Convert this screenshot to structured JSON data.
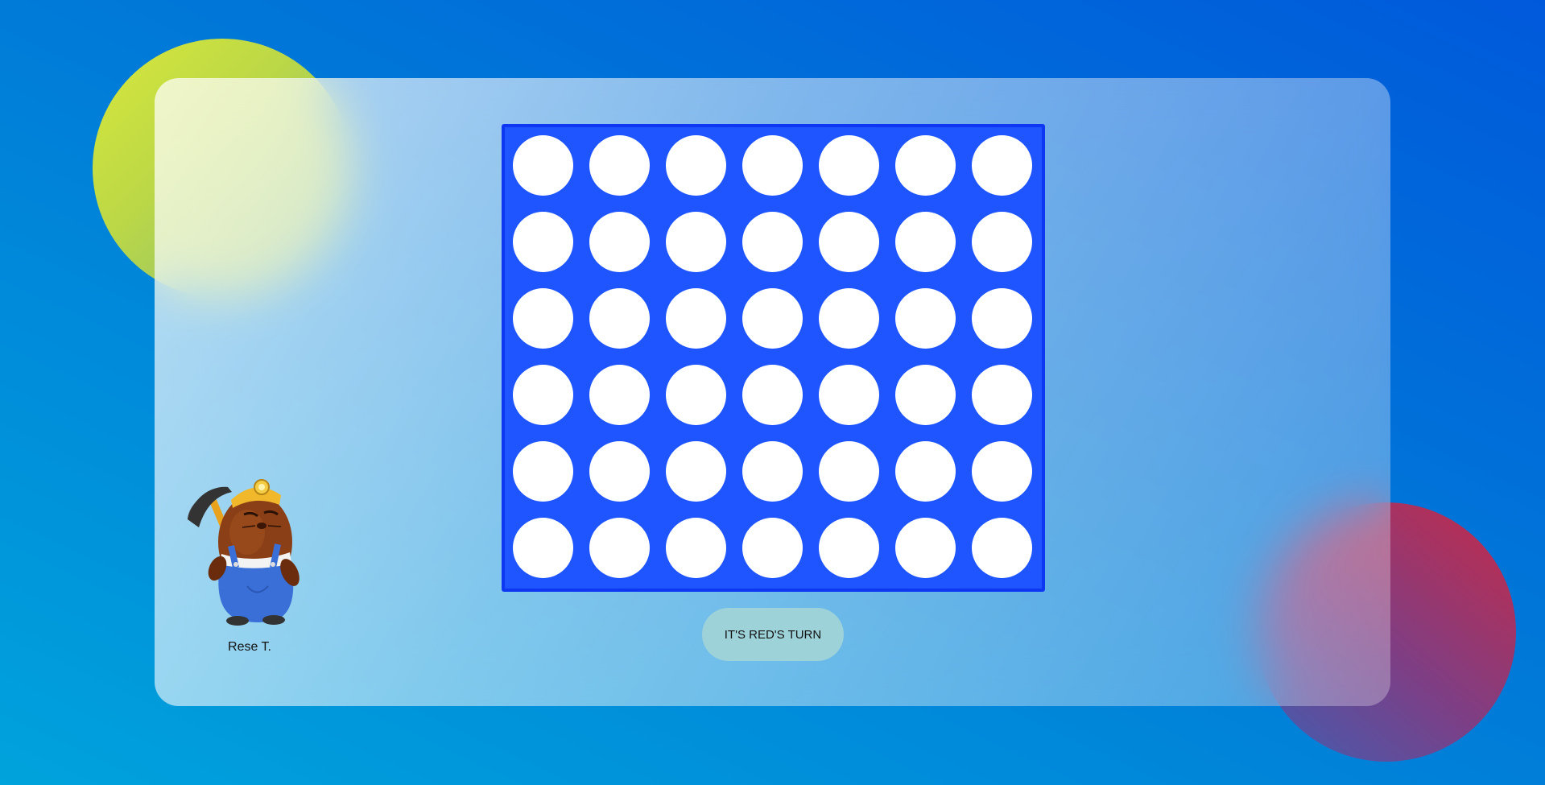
{
  "background": {
    "top_right_color": "#0059db",
    "bottom_left_color": "#00a3dc",
    "yellow_blob_color": "#d8e83c",
    "red_blob_color": "#c42a48"
  },
  "board": {
    "rows": 6,
    "columns": 7,
    "board_color": "#1f55ff",
    "empty_cell_color": "#ffffff",
    "cells": [
      [
        "empty",
        "empty",
        "empty",
        "empty",
        "empty",
        "empty",
        "empty"
      ],
      [
        "empty",
        "empty",
        "empty",
        "empty",
        "empty",
        "empty",
        "empty"
      ],
      [
        "empty",
        "empty",
        "empty",
        "empty",
        "empty",
        "empty",
        "empty"
      ],
      [
        "empty",
        "empty",
        "empty",
        "empty",
        "empty",
        "empty",
        "empty"
      ],
      [
        "empty",
        "empty",
        "empty",
        "empty",
        "empty",
        "empty",
        "empty"
      ],
      [
        "empty",
        "empty",
        "empty",
        "empty",
        "empty",
        "empty",
        "empty"
      ]
    ]
  },
  "status": {
    "turn_text": "IT'S RED'S TURN"
  },
  "player": {
    "name": "Rese T.",
    "avatar_icon": "mole-miner-character"
  }
}
